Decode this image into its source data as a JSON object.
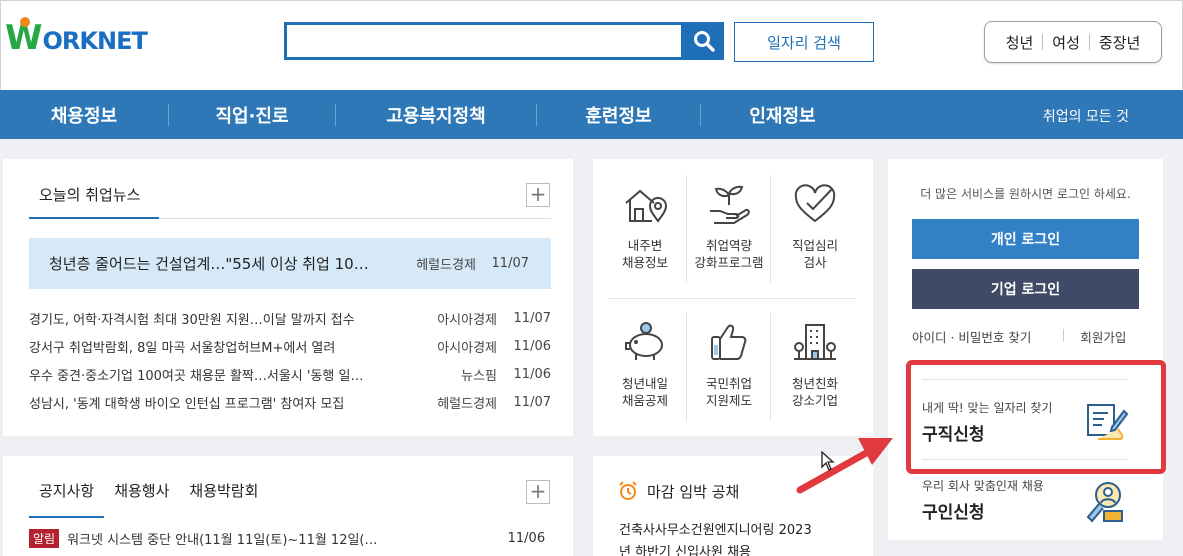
{
  "header": {
    "logo_text": "ORKNET",
    "logo_w": "W",
    "search_placeholder": "",
    "job_search_label": "일자리 검색",
    "segments": [
      "청년",
      "여성",
      "중장년"
    ]
  },
  "nav": {
    "items": [
      "채용정보",
      "직업·진로",
      "고용복지정책",
      "훈련정보",
      "인재정보"
    ],
    "all_label": "취업의 모든 것"
  },
  "news": {
    "tab_label": "오늘의 취업뉴스",
    "more_label": "+",
    "headline": {
      "title": "청년층 줄어드는 건설업계…\"55세 이상 취업 10…",
      "source": "헤럴드경제",
      "date": "11/07"
    },
    "items": [
      {
        "title": "경기도, 어학·자격시험 최대 30만원 지원…이달 말까지 접수",
        "source": "아시아경제",
        "date": "11/07"
      },
      {
        "title": "강서구 취업박람회, 8일 마곡 서울창업허브M+에서 열려",
        "source": "아시아경제",
        "date": "11/06"
      },
      {
        "title": "우수 중견·중소기업 100여곳 채용문 활짝…서울시 '동행 일…",
        "source": "뉴스핌",
        "date": "11/06"
      },
      {
        "title": "성남시, '동계 대학생 바이오 인턴십 프로그램' 참여자 모집",
        "source": "헤럴드경제",
        "date": "11/07"
      }
    ]
  },
  "notice": {
    "tabs": [
      "공지사항",
      "채용행사",
      "채용박람회"
    ],
    "more_label": "+",
    "row": {
      "badge": "알림",
      "title": "워크넷 시스템 중단 안내(11월 11일(토)~11월 12일(…",
      "date": "11/06"
    }
  },
  "services": [
    {
      "label1": "내주변",
      "label2": "채용정보",
      "icon": "house-location-icon"
    },
    {
      "label1": "취업역량",
      "label2": "강화프로그램",
      "icon": "sprout-hand-icon"
    },
    {
      "label1": "직업심리",
      "label2": "검사",
      "icon": "heart-check-icon"
    },
    {
      "label1": "청년내일",
      "label2": "채움공제",
      "icon": "piggy-bank-icon"
    },
    {
      "label1": "국민취업",
      "label2": "지원제도",
      "icon": "thumbs-up-icon"
    },
    {
      "label1": "청년친화",
      "label2": "강소기업",
      "icon": "building-icon"
    }
  ],
  "deadline": {
    "title": "마감 임박 공채",
    "company": "건축사사무소건원엔지니어링",
    "year": "2023",
    "desc": "년 하반기 신입사원 채용"
  },
  "login": {
    "message": "더 많은 서비스를 원하시면 로그인 하세요.",
    "personal_label": "개인 로그인",
    "company_label": "기업 로그인",
    "find_label": "아이디 · 비밀번호 찾기",
    "join_label": "회원가입",
    "job_seek_sub": "내게 딱! 맞는 일자리 찾기",
    "job_seek_title": "구직신청",
    "hire_sub": "우리 회사 맞춤인재 채용",
    "hire_title": "구인신청"
  },
  "colors": {
    "primary": "#1e6fb8",
    "nav_bg": "#2e78b8",
    "personal_btn": "#3280c6",
    "company_btn": "#3f4a66",
    "highlight": "#e03a3e",
    "headline_bg": "#d6e9f8"
  }
}
